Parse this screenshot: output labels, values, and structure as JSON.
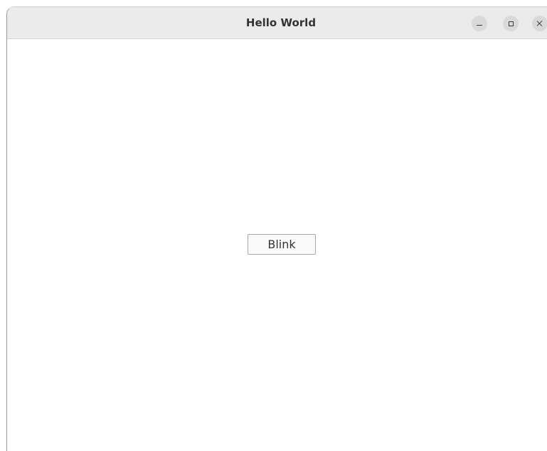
{
  "window": {
    "title": "Hello World"
  },
  "titlebar_controls": {
    "minimize_icon": "minimize-icon",
    "maximize_icon": "maximize-icon",
    "close_icon": "close-icon"
  },
  "main": {
    "blink_button_label": "Blink"
  },
  "colors": {
    "titlebar_bg": "#ebebeb",
    "window_bg": "#ffffff",
    "control_bg": "#d9d9d9",
    "text": "#333333"
  }
}
